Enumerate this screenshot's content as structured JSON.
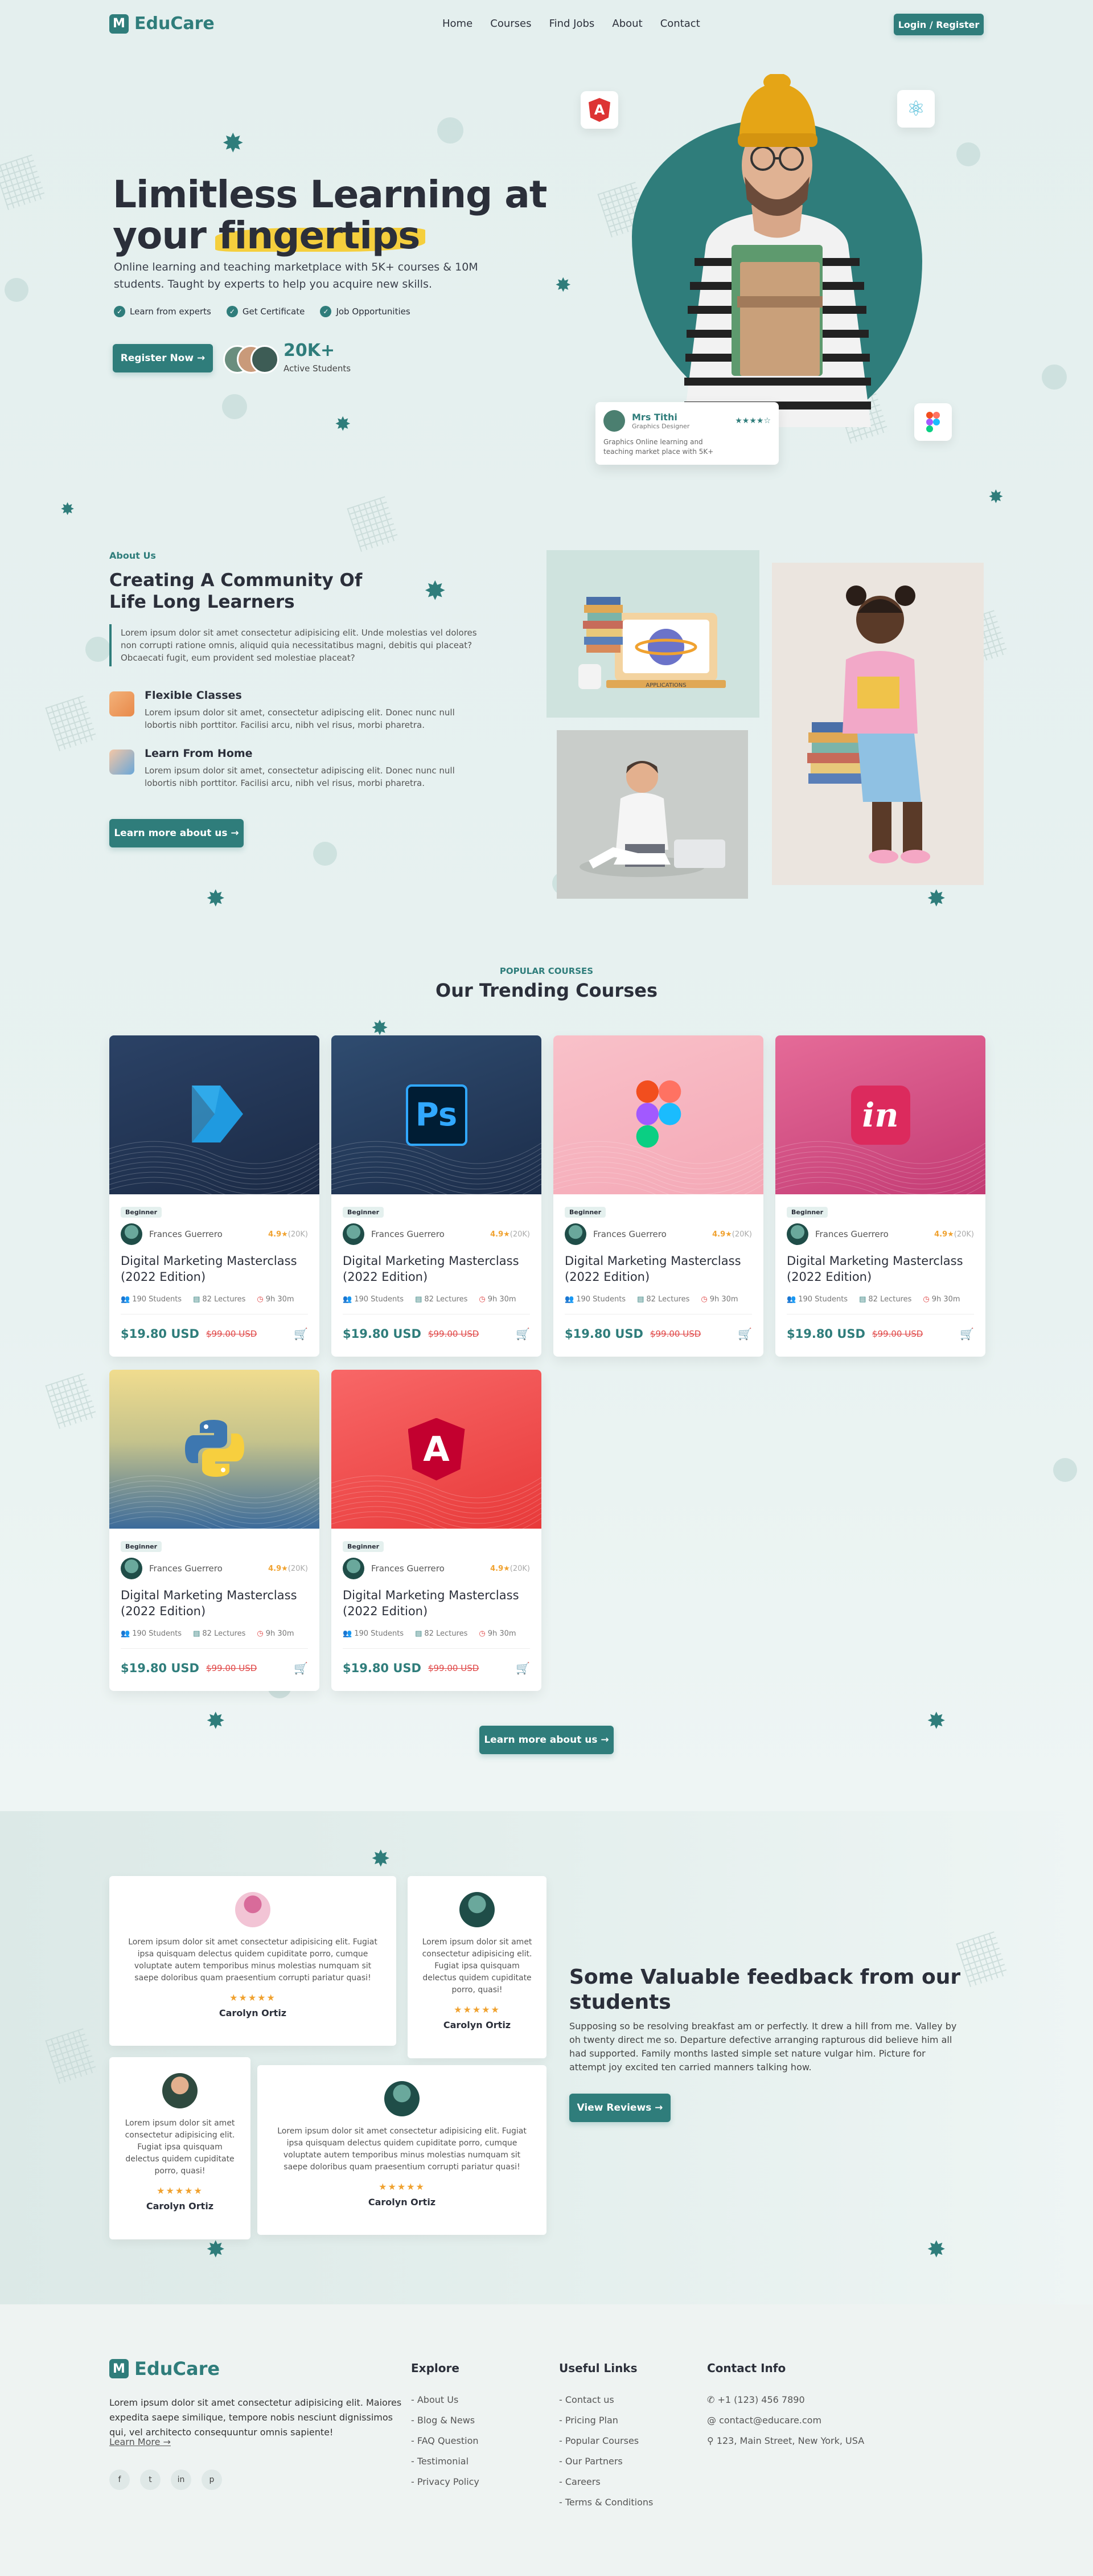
{
  "header": {
    "brand": "EduCare",
    "nav": [
      "Home",
      "Courses",
      "Find Jobs",
      "About",
      "Contact"
    ],
    "login_label": "Login / Register"
  },
  "hero": {
    "title_line1": "Limitless Learning at",
    "title_line2_prefix": "your ",
    "title_highlight": "fingertips",
    "subtitle": "Online learning and teaching marketplace with 5K+ courses & 10M students. Taught by experts to help you acquire new skills.",
    "checks": [
      "Learn from experts",
      "Get Certificate",
      "Job Opportunities"
    ],
    "cta": "Register Now →",
    "active_count": "20K+",
    "active_label": "Active Students",
    "profile_card": {
      "name": "Mrs Tithi",
      "role": "Graphics Designer",
      "desc": "Graphics Online learning and teaching market place with 5K+",
      "stars": "★★★★☆"
    },
    "icons": [
      "angular-icon",
      "react-icon",
      "figma-icon"
    ]
  },
  "about": {
    "tag": "About Us",
    "title": "Creating A Community Of Life Long Learners",
    "body": "Lorem ipsum dolor sit amet consectetur adipisicing elit. Unde molestias vel dolores non corrupti ratione omnis, aliquid quia necessitatibus magni, debitis qui placeat? Obcaecati fugit, eum provident sed molestiae placeat?",
    "features": [
      {
        "title": "Flexible Classes",
        "text": "Lorem ipsum dolor sit amet, consectetur adipiscing elit. Donec nunc null lobortis nibh porttitor. Facilisi arcu, nibh vel risus, morbi pharetra."
      },
      {
        "title": "Learn From Home",
        "text": "Lorem ipsum dolor sit amet, consectetur adipiscing elit. Donec nunc null lobortis nibh porttitor. Facilisi arcu, nibh vel risus, morbi pharetra."
      }
    ],
    "cta": "Learn more about us →",
    "book_sign": "APPLICATIONS"
  },
  "courses": {
    "tag": "POPULAR COURSES",
    "title": "Our Trending Courses",
    "items": [
      {
        "level": "Beginner",
        "instructor": "Frances Guerrero",
        "rating": "4.9★",
        "reviews": "(20K)",
        "title": "Digital Marketing Masterclass (2022 Edition)",
        "students": "190 Students",
        "lectures": "82 Lectures",
        "duration": "9h 30m",
        "price": "$19.80 USD",
        "old_price": "$99.00 USD",
        "theme": "navy",
        "logo": "chevron"
      },
      {
        "level": "Beginner",
        "instructor": "Frances Guerrero",
        "rating": "4.9★",
        "reviews": "(20K)",
        "title": "Digital Marketing Masterclass (2022 Edition)",
        "students": "190 Students",
        "lectures": "82 Lectures",
        "duration": "9h 30m",
        "price": "$19.80 USD",
        "old_price": "$99.00 USD",
        "theme": "navy2",
        "logo": "Ps"
      },
      {
        "level": "Beginner",
        "instructor": "Frances Guerrero",
        "rating": "4.9★",
        "reviews": "(20K)",
        "title": "Digital Marketing Masterclass (2022 Edition)",
        "students": "190 Students",
        "lectures": "82 Lectures",
        "duration": "9h 30m",
        "price": "$19.80 USD",
        "old_price": "$99.00 USD",
        "theme": "pink",
        "logo": "figma"
      },
      {
        "level": "Beginner",
        "instructor": "Frances Guerrero",
        "rating": "4.9★",
        "reviews": "(20K)",
        "title": "Digital Marketing Masterclass (2022 Edition)",
        "students": "190 Students",
        "lectures": "82 Lectures",
        "duration": "9h 30m",
        "price": "$19.80 USD",
        "old_price": "$99.00 USD",
        "theme": "magenta",
        "logo": "in"
      },
      {
        "level": "Beginner",
        "instructor": "Frances Guerrero",
        "rating": "4.9★",
        "reviews": "(20K)",
        "title": "Digital Marketing Masterclass (2022 Edition)",
        "students": "190 Students",
        "lectures": "82 Lectures",
        "duration": "9h 30m",
        "price": "$19.80 USD",
        "old_price": "$99.00 USD",
        "theme": "python",
        "logo": "python"
      },
      {
        "level": "Beginner",
        "instructor": "Frances Guerrero",
        "rating": "4.9★",
        "reviews": "(20K)",
        "title": "Digital Marketing Masterclass (2022 Edition)",
        "students": "190 Students",
        "lectures": "82 Lectures",
        "duration": "9h 30m",
        "price": "$19.80 USD",
        "old_price": "$99.00 USD",
        "theme": "red",
        "logo": "A"
      }
    ],
    "cta": "Learn more about us →"
  },
  "testimonials": {
    "title": "Some Valuable feedback from our students",
    "body": "Supposing so be resolving breakfast am or perfectly. It drew a hill from me. Valley by oh twenty direct me so. Departure defective arranging rapturous did believe him all had supported. Family months lasted simple set nature vulgar him. Picture for attempt joy excited ten carried manners talking how.",
    "cta": "View Reviews →",
    "reviews": [
      {
        "text": "Lorem ipsum dolor sit amet consectetur adipisicing elit. Fugiat ipsa quisquam delectus quidem cupiditate porro, cumque voluptate autem temporibus minus molestias numquam sit saepe doloribus quam praesentium corrupti pariatur quasi!",
        "stars": "★★★★★",
        "name": "Carolyn Ortiz"
      },
      {
        "text": "Lorem ipsum dolor sit amet consectetur adipisicing elit. Fugiat ipsa quisquam delectus quidem cupiditate porro, quasi!",
        "stars": "★★★★★",
        "name": "Carolyn Ortiz"
      },
      {
        "text": "Lorem ipsum dolor sit amet consectetur adipisicing elit. Fugiat ipsa quisquam delectus quidem cupiditate porro, quasi!",
        "stars": "★★★★★",
        "name": "Carolyn Ortiz"
      },
      {
        "text": "Lorem ipsum dolor sit amet consectetur adipisicing elit. Fugiat ipsa quisquam delectus quidem cupiditate porro, cumque voluptate autem temporibus minus molestias numquam sit saepe doloribus quam praesentium corrupti pariatur quasi!",
        "stars": "★★★★★",
        "name": "Carolyn Ortiz"
      }
    ]
  },
  "footer": {
    "brand": "EduCare",
    "about": "Lorem ipsum dolor sit amet consectetur adipisicing elit. Maiores expedita saepe similique, tempore nobis nesciunt dignissimos qui, vel architecto consequuntur omnis sapiente!",
    "learn_more": "Learn More →",
    "explore_title": "Explore",
    "explore": [
      "About Us",
      "Blog & News",
      "FAQ Question",
      "Testimonial",
      "Privacy Policy"
    ],
    "links_title": "Useful Links",
    "links": [
      "Contact us",
      "Pricing Plan",
      "Popular Courses",
      "Our Partners",
      "Careers",
      "Terms & Conditions"
    ],
    "contact_title": "Contact Info",
    "phone": "+1 (123) 456 7890",
    "email": "contact@educare.com",
    "address": "123, Main Street, New York, USA",
    "social": [
      "f",
      "t",
      "in",
      "p"
    ]
  },
  "colors": {
    "primary": "#2f7d7b",
    "accent": "#f5cf3d",
    "price_old": "#e04848",
    "star": "#f0a230"
  }
}
